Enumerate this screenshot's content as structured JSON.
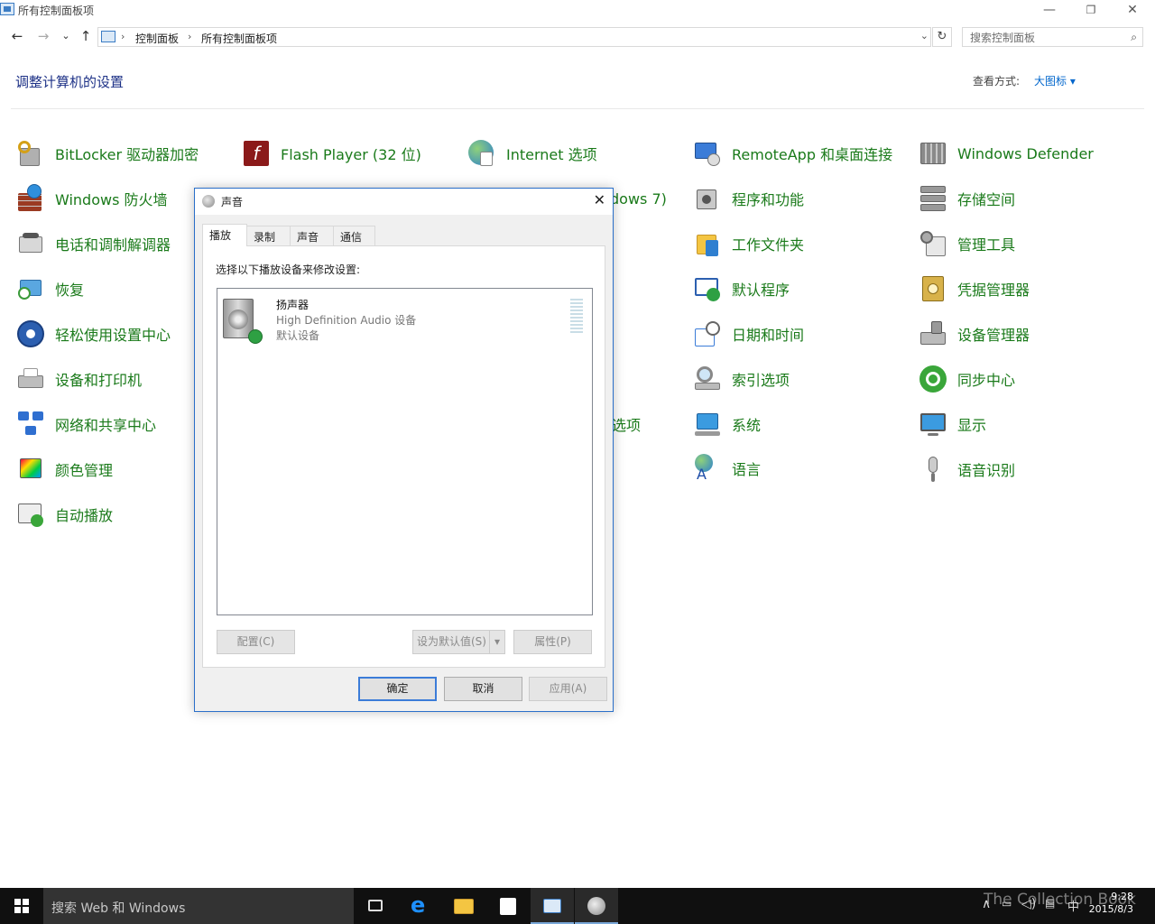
{
  "window": {
    "title": "所有控制面板项",
    "minimize": "—",
    "restore": "❐",
    "close": "✕"
  },
  "nav": {
    "back": "←",
    "forward": "→",
    "recent": "⌄",
    "up": "↑",
    "breadcrumbs": [
      "控制面板",
      "所有控制面板项"
    ],
    "refresh": "↻",
    "search_placeholder": "搜索控制面板"
  },
  "page": {
    "heading": "调整计算机的设置",
    "view_by_label": "查看方式:",
    "view_by_value": "大图标 ▾"
  },
  "items": {
    "col1": [
      "BitLocker 驱动器加密",
      "Windows 防火墙",
      "电话和调制解调器",
      "恢复",
      "轻松使用设置中心",
      "设备和打印机",
      "网络和共享中心",
      "颜色管理",
      "自动播放"
    ],
    "col2": [
      "Flash Player (32 位)"
    ],
    "col3": [
      "Internet 选项",
      "dows 7)",
      "选项"
    ],
    "col4": [
      "RemoteApp 和桌面连接",
      "程序和功能",
      "工作文件夹",
      "默认程序",
      "日期和时间",
      "索引选项",
      "系统",
      "语言"
    ],
    "col5": [
      "Windows Defender",
      "存储空间",
      "管理工具",
      "凭据管理器",
      "设备管理器",
      "同步中心",
      "显示",
      "语音识别"
    ]
  },
  "dialog": {
    "title": "声音",
    "close": "✕",
    "tabs": [
      "播放",
      "录制",
      "声音",
      "通信"
    ],
    "active_tab": "播放",
    "instruction": "选择以下播放设备来修改设置:",
    "device": {
      "name": "扬声器",
      "description": "High Definition Audio 设备",
      "status": "默认设备"
    },
    "buttons": {
      "configure": "配置(C)",
      "set_default": "设为默认值(S)",
      "properties": "属性(P)",
      "ok": "确定",
      "cancel": "取消",
      "apply": "应用(A)"
    }
  },
  "taskbar": {
    "search_placeholder": "搜索 Web 和 Windows",
    "watermark": "The Collection Book",
    "ime": "中",
    "time": "9:28",
    "date": "2015/8/3"
  },
  "colors": {
    "link_green": "#1a7a1a",
    "heading_blue": "#1e3287",
    "accent": "#2a6fc9"
  }
}
